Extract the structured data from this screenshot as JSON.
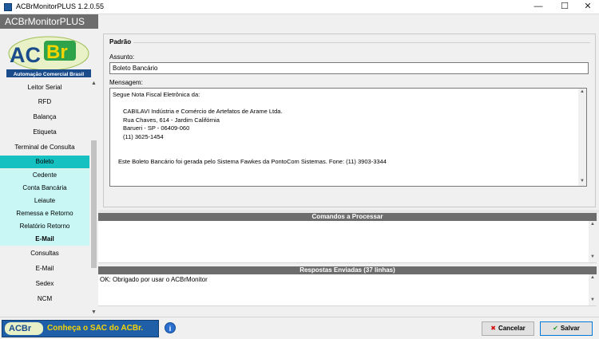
{
  "window": {
    "title": "ACBrMonitorPLUS 1.2.0.55",
    "minimize": "—",
    "maximize": "☐",
    "close": "✕"
  },
  "app": {
    "header": "ACBrMonitorPLUS",
    "logo_text": "ACBr",
    "logo_sub": "Automação Comercial Brasil"
  },
  "sidebar": {
    "items": [
      {
        "label": "Leitor Serial"
      },
      {
        "label": "RFD"
      },
      {
        "label": "Balança"
      },
      {
        "label": "Etiqueta"
      },
      {
        "label": "Terminal de Consulta"
      },
      {
        "label": "Boleto"
      },
      {
        "label": "Cedente"
      },
      {
        "label": "Conta Bancária"
      },
      {
        "label": "Leiaute"
      },
      {
        "label": "Remessa e Retorno"
      },
      {
        "label": "Relatório Retorno"
      },
      {
        "label": "E-Mail"
      },
      {
        "label": "Consultas"
      },
      {
        "label": "E-Mail"
      },
      {
        "label": "Sedex"
      },
      {
        "label": "NCM"
      }
    ]
  },
  "form": {
    "group_title": "Padrão",
    "subject_label": "Assunto:",
    "subject_value": "Boleto Bancário",
    "message_label": "Mensagem:",
    "message_lines": [
      "Segue Nota Fiscal Eletrônica da:",
      "CABILAVI Indústria e Comércio de Artefatos de Arame Ltda.",
      "Rua Chaves, 614 - Jardim Califórnia",
      "Barueri - SP - 06409-060",
      "(11) 3625-1454",
      "Este Boleto Bancário foi gerada pelo Sistema Fawkes da PontoCom Sistemas. Fone: (11) 3903-3344"
    ]
  },
  "commands_panel": {
    "title": "Comandos a Processar"
  },
  "responses_panel": {
    "title": "Respostas Enviadas (37 linhas)",
    "lines": [
      "OK: Obrigado por usar o ACBrMonitor"
    ]
  },
  "footer": {
    "sac_logo": "ACBr",
    "sac_text": "Conheça o SAC do ACBr.",
    "info": "i",
    "cancel_label": "Cancelar",
    "save_label": "Salvar"
  }
}
